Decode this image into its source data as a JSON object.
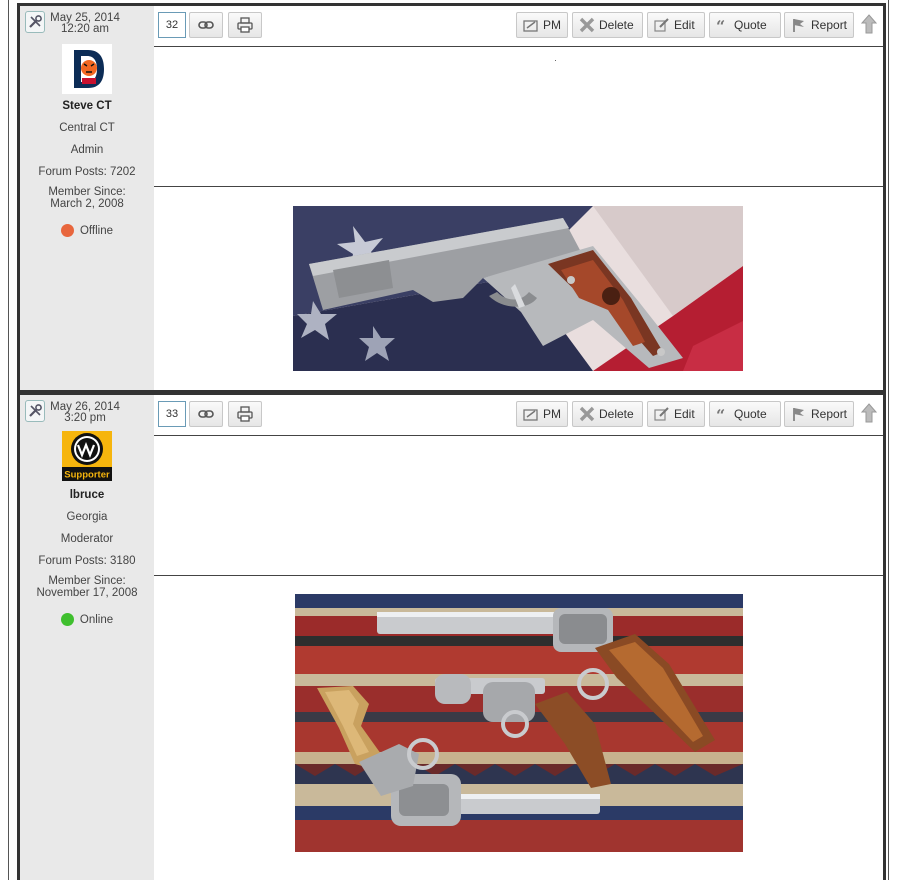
{
  "posts": [
    {
      "date": "May 25, 2014",
      "time": "12:20 am",
      "username": "Steve CT",
      "location": "Central CT",
      "role": "Admin",
      "forum_posts": "Forum Posts: 7202",
      "member_since_label": "Member Since:",
      "member_since_date": "March 2, 2008",
      "status": "Offline",
      "status_color": "#e8663d",
      "post_number": "32",
      "avatar_icon": "detroit-tigers-logo",
      "signature_image": "1911-pistol-on-flag"
    },
    {
      "date": "May 26, 2014",
      "time": "3:20 pm",
      "username": "lbruce",
      "location": "Georgia",
      "role": "Moderator",
      "forum_posts": "Forum Posts: 3180",
      "member_since_label": "Member Since:",
      "member_since_date": "November 17, 2008",
      "status": "Online",
      "status_color": "#3fbf2e",
      "post_number": "33",
      "avatar_text": "Supporter",
      "avatar_icon": "dw-supporter-badge",
      "signature_image": "three-revolvers-on-blanket"
    }
  ],
  "buttons": {
    "pm": "PM",
    "delete": "Delete",
    "edit": "Edit",
    "quote": "Quote",
    "report": "Report"
  }
}
